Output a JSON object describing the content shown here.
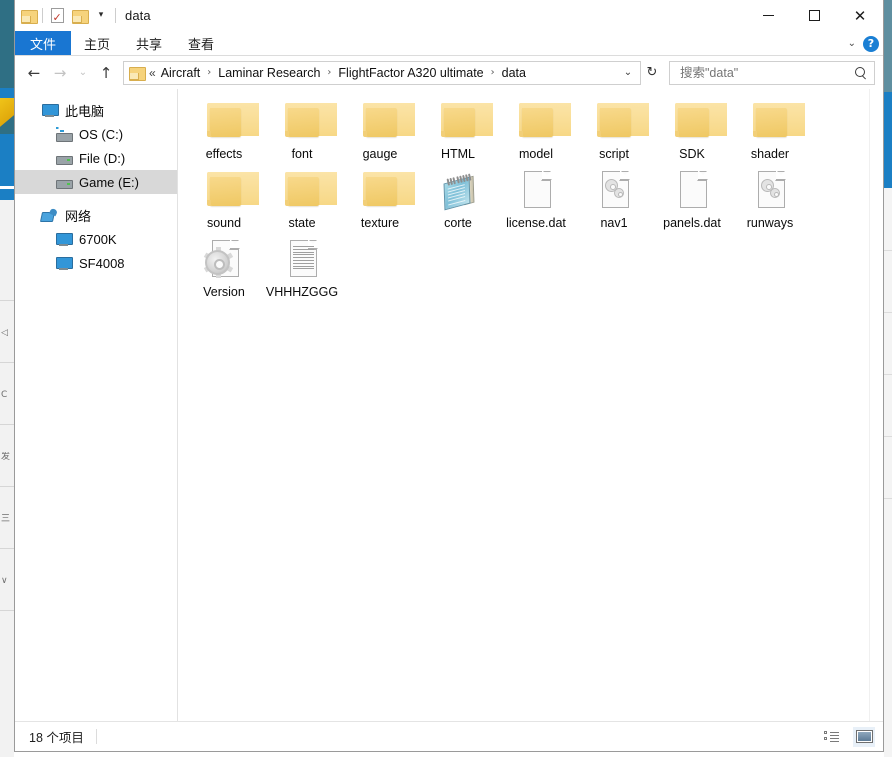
{
  "window": {
    "title": "data",
    "quick_access": [
      {
        "name": "folder-icon",
        "label": "文件夹"
      },
      {
        "name": "properties-icon",
        "label": "属性"
      },
      {
        "name": "new-folder-icon",
        "label": "新建文件夹"
      }
    ],
    "qat_dropdown": "▾",
    "controls": {
      "minimize": "—",
      "maximize": "□",
      "close": "✕"
    }
  },
  "ribbon": {
    "tabs": [
      {
        "label": "文件",
        "active": true
      },
      {
        "label": "主页",
        "active": false
      },
      {
        "label": "共享",
        "active": false
      },
      {
        "label": "查看",
        "active": false
      }
    ],
    "collapse_caret": "⌄",
    "help_label": "?"
  },
  "toolbar": {
    "back": "←",
    "forward": "→",
    "recent": "⌄",
    "up": "↑",
    "refresh": "↻",
    "address_caret": "⌄"
  },
  "address": {
    "root_prefix": "«",
    "crumbs": [
      "Aircraft",
      "Laminar Research",
      "FlightFactor A320 ultimate",
      "data"
    ],
    "separator": "›"
  },
  "search": {
    "placeholder": "搜索\"data\"",
    "value": ""
  },
  "sidebar": {
    "groups": [
      {
        "label": "此电脑",
        "icon": "pc-icon",
        "children": [
          {
            "label": "OS (C:)",
            "icon": "drive-os-icon",
            "selected": false
          },
          {
            "label": "File (D:)",
            "icon": "drive-icon",
            "selected": false
          },
          {
            "label": "Game (E:)",
            "icon": "drive-icon",
            "selected": true
          }
        ]
      },
      {
        "label": "网络",
        "icon": "network-icon",
        "children": [
          {
            "label": "6700K",
            "icon": "pc-icon",
            "selected": false
          },
          {
            "label": "SF4008",
            "icon": "pc-icon",
            "selected": false
          }
        ]
      }
    ]
  },
  "files": [
    {
      "name": "effects",
      "type": "folder"
    },
    {
      "name": "font",
      "type": "folder"
    },
    {
      "name": "gauge",
      "type": "folder"
    },
    {
      "name": "HTML",
      "type": "folder"
    },
    {
      "name": "model",
      "type": "folder"
    },
    {
      "name": "script",
      "type": "folder"
    },
    {
      "name": "SDK",
      "type": "folder"
    },
    {
      "name": "shader",
      "type": "folder"
    },
    {
      "name": "sound",
      "type": "folder"
    },
    {
      "name": "state",
      "type": "folder"
    },
    {
      "name": "texture",
      "type": "folder"
    },
    {
      "name": "corte",
      "type": "notepad"
    },
    {
      "name": "license.dat",
      "type": "document"
    },
    {
      "name": "nav1",
      "type": "config"
    },
    {
      "name": "panels.dat",
      "type": "document"
    },
    {
      "name": "runways",
      "type": "config"
    },
    {
      "name": "Version",
      "type": "gear"
    },
    {
      "name": "VHHHZGGG",
      "type": "textfile"
    }
  ],
  "status": {
    "item_count": "18 个项目",
    "views": [
      {
        "name": "details-view-button",
        "active": false
      },
      {
        "name": "large-icons-view-button",
        "active": true
      }
    ]
  },
  "colors": {
    "accent": "#1976d2",
    "folder": "#f5cf73",
    "selection": "#d8d8d8",
    "help_blue": "#1a7fd4"
  }
}
